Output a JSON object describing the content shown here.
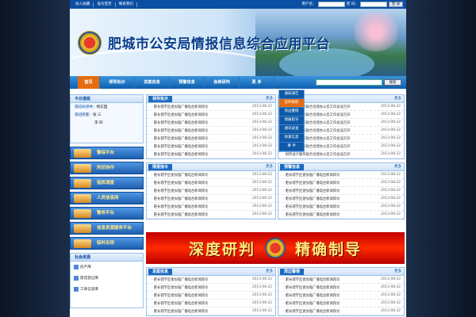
{
  "topbar": {
    "links": [
      "加入收藏",
      "设为首页",
      "联系我们"
    ],
    "username_label": "用户名：",
    "password_label": "密 码：",
    "login_button": "登 录"
  },
  "banner": {
    "title": "肥城市公安局情报信息综合应用平台"
  },
  "nav": {
    "items": [
      "首页",
      "领导批示",
      "发案信息",
      "预警信息",
      "会商研判",
      "更 多"
    ],
    "search_button": "搜索"
  },
  "dropdown": {
    "items": [
      "通知通告",
      "案件跟踪",
      "周边警情",
      "情报指令",
      "通讯录查",
      "财富信息",
      "事 件"
    ]
  },
  "today": {
    "title": "今日值班",
    "rows": [
      {
        "label": "值班局领导：",
        "value": "杨志国"
      },
      {
        "label": "值班民警：",
        "value": "张 三"
      },
      {
        "label": "",
        "value": "李 四"
      }
    ]
  },
  "left_nav": [
    "警综平台",
    "刑侦协作",
    "指挥调度",
    "人员信息网",
    "警务平台",
    "信息资源服务平台",
    "临时名称"
  ],
  "social": {
    "title": "社会资源",
    "items": [
      "房产库",
      "旅馆登记库",
      "工商信息库"
    ]
  },
  "panels": {
    "leader": {
      "title": "领导批示",
      "more": "更多"
    },
    "intel": {
      "title": "情报指令",
      "more": "更多"
    },
    "warning": {
      "title": "预警信息",
      "more": "更多"
    },
    "incident": {
      "title": "发案信息",
      "more": "更多"
    },
    "nearby": {
      "title": "周边警情",
      "more": "更多"
    },
    "notice": {
      "more": "更多"
    }
  },
  "rows": {
    "a": "肥长辖字区委加强广播电台新闻舆论",
    "b": "肥长辖字区委加强广播电台新闻舆论",
    "c": "财务会计服务联合治理办公室工作会议召开",
    "date": "2013-08-22"
  },
  "big_banner": {
    "left": "深度研判",
    "right": "精确制导"
  }
}
